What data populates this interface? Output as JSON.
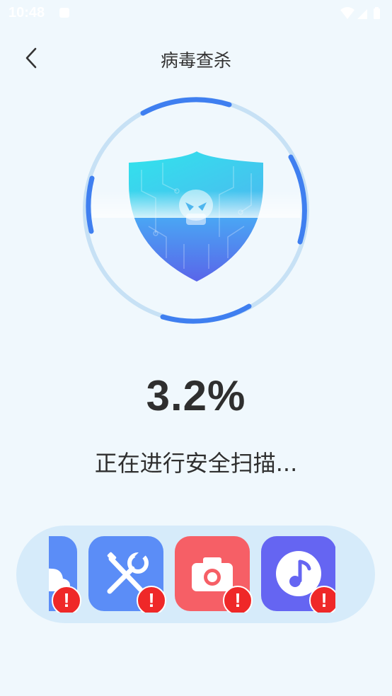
{
  "status_bar": {
    "time": "10:48"
  },
  "header": {
    "title": "病毒查杀"
  },
  "scan": {
    "percent": "3.2%",
    "status": "正在进行安全扫描..."
  },
  "apps": [
    {
      "name": "cloud-app-icon",
      "color": "#5b8df7",
      "warning": "!"
    },
    {
      "name": "tools-app-icon",
      "color": "#5b8df7",
      "warning": "!"
    },
    {
      "name": "camera-app-icon",
      "color": "#f65f66",
      "warning": "!"
    },
    {
      "name": "music-app-icon",
      "color": "#6565f2",
      "warning": "!"
    }
  ],
  "colors": {
    "ring": "#3f7ff0",
    "background": "#f0f8fd",
    "tray": "#d6ebfa"
  }
}
